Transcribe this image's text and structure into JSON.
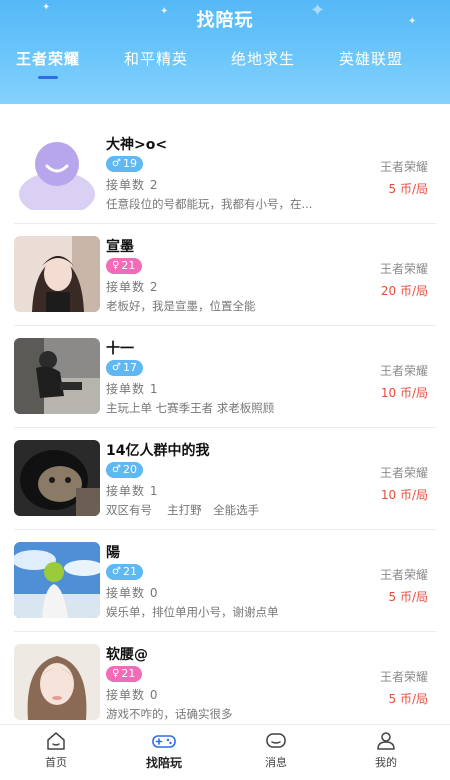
{
  "app": {
    "title": "找陪玩"
  },
  "tabs": [
    {
      "label": "王者荣耀",
      "active": true
    },
    {
      "label": "和平精英",
      "active": false
    },
    {
      "label": "绝地求生",
      "active": false
    },
    {
      "label": "英雄联盟",
      "active": false
    }
  ],
  "players": [
    {
      "name": "大神>o<",
      "gender": "male",
      "age": "19",
      "orders_label": "接单数",
      "orders": "2",
      "desc": "任意段位的号都能玩，我都有小号，在...",
      "game": "王者荣耀",
      "price": "5 币/局"
    },
    {
      "name": "宣墨",
      "gender": "female",
      "age": "21",
      "orders_label": "接单数",
      "orders": "2",
      "desc": "老板好，我是宣墨，位置全能",
      "game": "王者荣耀",
      "price": "20 币/局"
    },
    {
      "name": "十一",
      "gender": "male",
      "age": "17",
      "orders_label": "接单数",
      "orders": "1",
      "desc": "主玩上单 七赛季王者 求老板照顾",
      "game": "王者荣耀",
      "price": "10 币/局"
    },
    {
      "name": "14亿人群中的我",
      "gender": "male",
      "age": "20",
      "orders_label": "接单数",
      "orders": "1",
      "desc": "双区有号　 主打野　全能选手",
      "game": "王者荣耀",
      "price": "10 币/局"
    },
    {
      "name": "陽",
      "gender": "male",
      "age": "21",
      "orders_label": "接单数",
      "orders": "0",
      "desc": "娱乐单，排位单用小号，谢谢点单",
      "game": "王者荣耀",
      "price": "5 币/局"
    },
    {
      "name": "软腰@",
      "gender": "female",
      "age": "21",
      "orders_label": "接单数",
      "orders": "0",
      "desc": "游戏不咋的，话确实很多",
      "game": "王者荣耀",
      "price": "5 币/局"
    }
  ],
  "nav": [
    {
      "label": "首页",
      "icon": "home-icon",
      "active": false
    },
    {
      "label": "找陪玩",
      "icon": "gamepad-icon",
      "active": true
    },
    {
      "label": "消息",
      "icon": "message-icon",
      "active": false
    },
    {
      "label": "我的",
      "icon": "profile-icon",
      "active": false
    }
  ],
  "colors": {
    "header": "#6cc6fb",
    "accent": "#2f6ee8",
    "price": "#e94b3c",
    "male": "#5fb8f1",
    "female": "#f06bb8"
  }
}
